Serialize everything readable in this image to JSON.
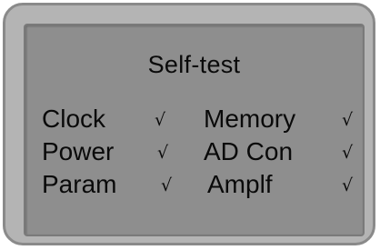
{
  "screen": {
    "title": "Self-test",
    "items": [
      {
        "label": "Clock",
        "status": "√"
      },
      {
        "label": "Memory",
        "status": "√"
      },
      {
        "label": "Power",
        "status": "√"
      },
      {
        "label": "AD Con",
        "status": "√"
      },
      {
        "label": "Param",
        "status": "√"
      },
      {
        "label": "Amplf",
        "status": "√"
      }
    ]
  },
  "colors": {
    "bezel": "#b4b4b4",
    "screen_background": "#8e8e8e",
    "text": "#0a0a0a"
  }
}
